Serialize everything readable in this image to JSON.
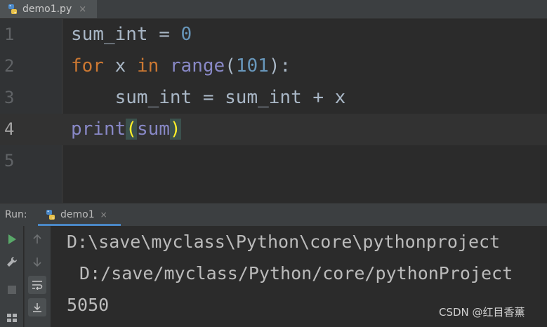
{
  "editor_tab": {
    "filename": "demo1.py",
    "close": "×"
  },
  "code_lines": [
    {
      "num": "1"
    },
    {
      "num": "2"
    },
    {
      "num": "3"
    },
    {
      "num": "4"
    },
    {
      "num": "5"
    }
  ],
  "code": {
    "l1_text": "sum_int = ",
    "l1_num": "0",
    "l2_for": "for",
    "l2_x": " x ",
    "l2_in": "in",
    "l2_sp": " ",
    "l2_range": "range",
    "l2_open": "(",
    "l2_num": "101",
    "l2_close": "):",
    "l3_text": "    sum_int = sum_int + x",
    "l4_print": "print",
    "l4_open": "(",
    "l4_arg": "sum",
    "l4_close": ")"
  },
  "run": {
    "title": "Run:",
    "tab_label": "demo1",
    "close": "×"
  },
  "console_lines": [
    "D:\\save\\myclass\\Python\\core\\pythonproject",
    " D:/save/myclass/Python/core/pythonProject",
    "5050"
  ],
  "watermark": "CSDN @红目香薰",
  "icons": {
    "editor_tab": "python-file-icon",
    "run_tab": "python-icon",
    "toolbar": [
      "run-icon",
      "wrench-icon",
      "stop-icon",
      "layout-icon",
      "up-arrow-icon",
      "down-arrow-icon",
      "soft-wrap-icon",
      "scroll-to-end-icon"
    ]
  },
  "colors": {
    "keyword": "#cc7832",
    "number": "#6897bb",
    "builtin": "#8888c6",
    "paren_highlight": "#ffef28",
    "run_green": "#59a869"
  }
}
